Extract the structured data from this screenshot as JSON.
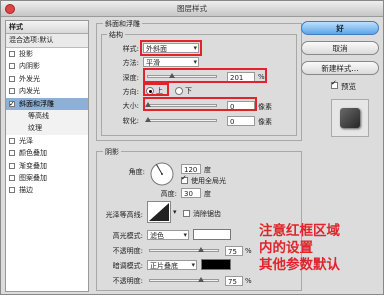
{
  "window": {
    "title": "图层样式"
  },
  "style_list": {
    "header": "样式",
    "blend_options": "混合选项:默认",
    "items": [
      {
        "label": "投影",
        "checked": false,
        "sub": false,
        "selected": false
      },
      {
        "label": "内阴影",
        "checked": false,
        "sub": false,
        "selected": false
      },
      {
        "label": "外发光",
        "checked": false,
        "sub": false,
        "selected": false
      },
      {
        "label": "内发光",
        "checked": false,
        "sub": false,
        "selected": false
      },
      {
        "label": "斜面和浮雕",
        "checked": true,
        "sub": false,
        "selected": true
      },
      {
        "label": "等高线",
        "checked": false,
        "sub": true,
        "selected": false
      },
      {
        "label": "纹理",
        "checked": false,
        "sub": true,
        "selected": false
      },
      {
        "label": "光泽",
        "checked": false,
        "sub": false,
        "selected": false
      },
      {
        "label": "颜色叠加",
        "checked": false,
        "sub": false,
        "selected": false
      },
      {
        "label": "渐变叠加",
        "checked": false,
        "sub": false,
        "selected": false
      },
      {
        "label": "图案叠加",
        "checked": false,
        "sub": false,
        "selected": false
      },
      {
        "label": "描边",
        "checked": false,
        "sub": false,
        "selected": false
      }
    ]
  },
  "bevel": {
    "section_title": "斜面和浮雕",
    "structure_title": "结构",
    "style_label": "样式:",
    "style_value": "外斜面",
    "technique_label": "方法:",
    "technique_value": "平滑",
    "depth_label": "深度:",
    "depth_value": "201",
    "depth_unit": "%",
    "direction_label": "方向:",
    "direction_up": "上",
    "direction_down": "下",
    "size_label": "大小:",
    "size_value": "0",
    "size_unit": "像素",
    "soften_label": "软化:",
    "soften_value": "0",
    "soften_unit": "像素"
  },
  "shading": {
    "title": "阴影",
    "angle_label": "角度:",
    "angle_value": "120",
    "angle_unit": "度",
    "global_light_label": "使用全局光",
    "altitude_label": "高度:",
    "altitude_value": "30",
    "altitude_unit": "度",
    "gloss_contour_label": "光泽等高线:",
    "antialias_label": "消除锯齿",
    "highlight_mode_label": "高光模式:",
    "highlight_mode_value": "滤色",
    "highlight_opacity_label": "不透明度:",
    "highlight_opacity_value": "75",
    "shadow_mode_label": "暗调模式:",
    "shadow_mode_value": "正片叠底",
    "shadow_opacity_label": "不透明度:",
    "shadow_opacity_value": "75",
    "percent": "%"
  },
  "buttons": {
    "ok": "好",
    "cancel": "取消",
    "new_style": "新建样式...",
    "preview": "预览"
  },
  "annotation": {
    "line1": "注意红框区域",
    "line2": "内的设置",
    "line3": "其他参数默认"
  },
  "colors": {
    "highlight_box": "#e0242a",
    "selected_item": "#8fb0d6",
    "primary_button": "#5ca6e8",
    "highlight_color_swatch": "#ffffff",
    "shadow_color_swatch": "#000000"
  }
}
